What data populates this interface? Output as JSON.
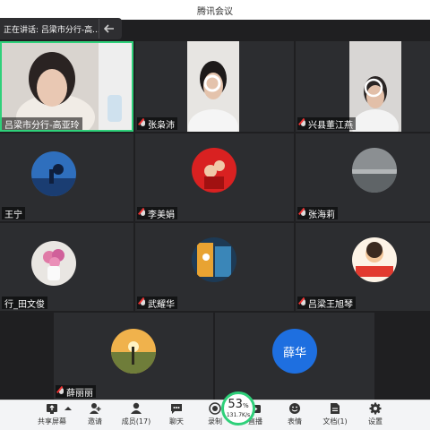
{
  "window": {
    "title": "腾讯会议"
  },
  "speaker_banner": {
    "text": "正在讲话: 吕梁市分行-高..."
  },
  "participants": [
    {
      "name": "吕梁市分行-高亚玲",
      "active": true
    },
    {
      "name": "张枭沛"
    },
    {
      "name": "兴县董江燕"
    },
    {
      "name": "王宁"
    },
    {
      "name": "李美娟"
    },
    {
      "name": "张海莉"
    },
    {
      "name": "行_田文俊"
    },
    {
      "name": "武耀华"
    },
    {
      "name": "吕梁王旭琴"
    },
    {
      "name": "薛丽丽"
    },
    {
      "name": "薛华",
      "avatar_text": "薛华"
    }
  ],
  "network": {
    "percent": "53",
    "percent_unit": "%",
    "rate": "131.7K/s"
  },
  "toolbar": {
    "share": "共享屏幕",
    "invite": "邀请",
    "members": "成员(17)",
    "chat": "聊天",
    "record": "录制",
    "live": "直播",
    "reactions": "表情",
    "docs": "文档(1)",
    "settings": "设置"
  },
  "colors": {
    "accent_green": "#2fd07a",
    "avatar_blue": "#1e6fe0",
    "toolbar_bg": "#f3f4f6"
  }
}
